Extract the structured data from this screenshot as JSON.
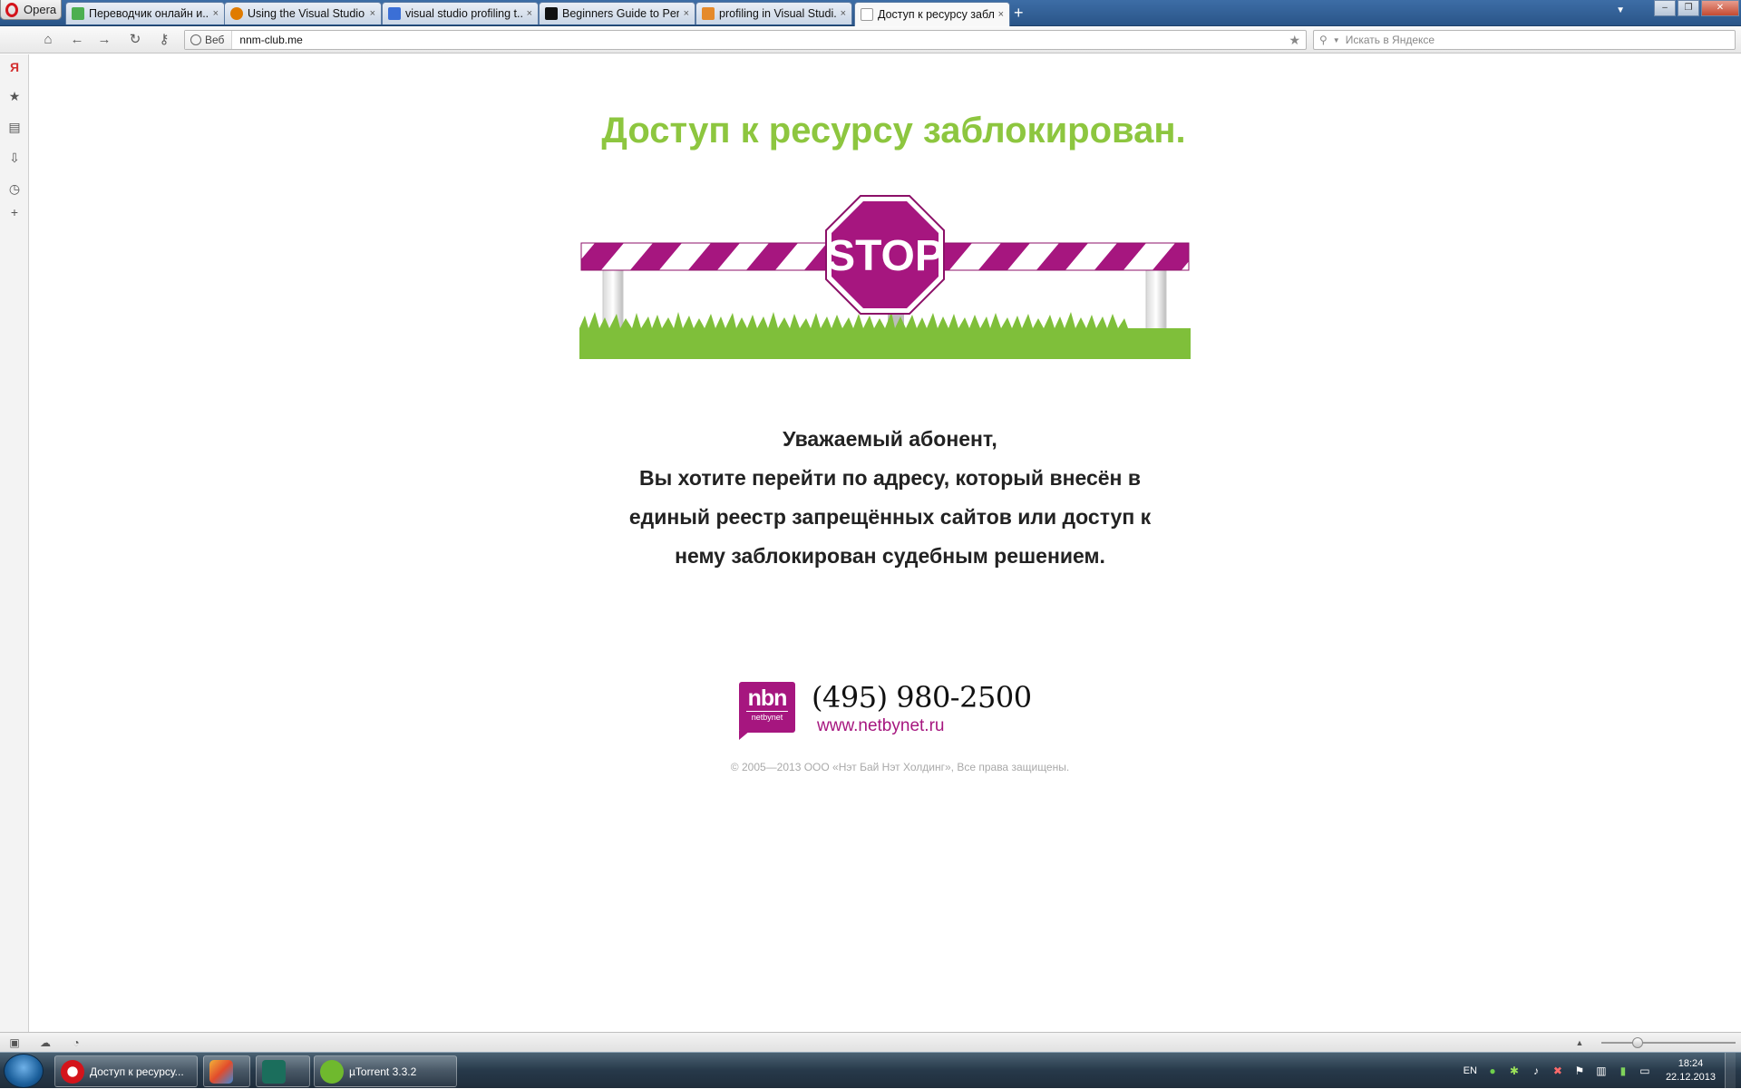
{
  "browser": {
    "menu_label": "Opera",
    "tabs": [
      {
        "title": "Переводчик онлайн и...",
        "fav_color": "#4caf50",
        "active": false
      },
      {
        "title": "Using the Visual Studio...",
        "fav_color": "#e07b00",
        "active": false
      },
      {
        "title": "visual studio profiling t...",
        "fav_color": "#3b6fd6",
        "active": false
      },
      {
        "title": "Beginners Guide to Per...",
        "fav_color": "#111111",
        "active": false
      },
      {
        "title": "profiling in Visual Studi...",
        "fav_color": "#e58a2b",
        "active": false
      },
      {
        "title": "Доступ к ресурсу забл...",
        "fav_color": "#ffffff",
        "active": true
      }
    ],
    "new_tab_label": "+",
    "close_glyph": "×",
    "address": {
      "badge_label": "Веб",
      "url": "nnm-club.me"
    },
    "search": {
      "placeholder": "Искать в Яндексе"
    }
  },
  "page": {
    "headline": "Доступ к ресурсу заблокирован.",
    "stop_sign_text": "STOP",
    "message_lines": [
      "Уважаемый абонент,",
      "Вы хотите перейти по адресу, который внесён в",
      "единый реестр запрещённых сайтов или доступ к",
      "нему заблокирован судебным решением."
    ],
    "logo_big": "nbn",
    "logo_small": "netbynet",
    "phone": "(495) 980-2500",
    "website": "www.netbynet.ru",
    "copyright": "© 2005—2013 ООО «Нэт Бай Нэт Холдинг», Все права защищены.",
    "colors": {
      "headline": "#8dc63f",
      "brand_purple": "#a6167f"
    }
  },
  "taskbar": {
    "tasks": [
      {
        "label": "Доступ к ресурсу...",
        "icon": "opera-icon"
      },
      {
        "label": "",
        "icon": "paint-icon"
      },
      {
        "label": "",
        "icon": "app-icon"
      },
      {
        "label": "µTorrent 3.3.2",
        "icon": "utorrent-icon"
      }
    ],
    "language": "EN",
    "time": "18:24",
    "date": "22.12.2013"
  }
}
